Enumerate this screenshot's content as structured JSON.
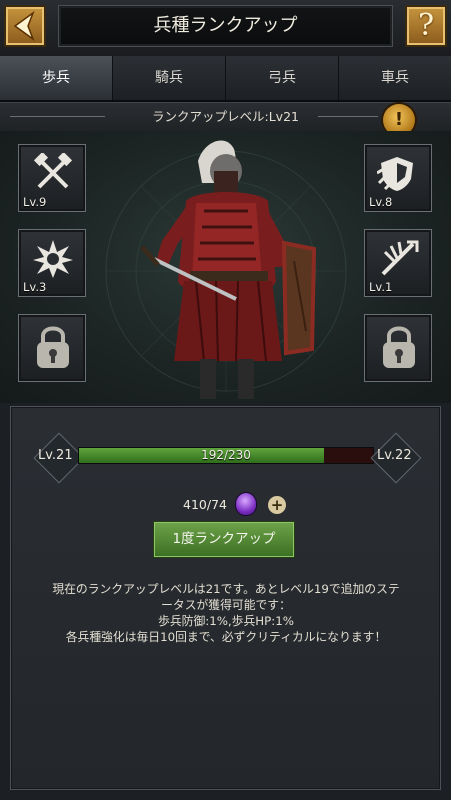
{
  "header": {
    "title": "兵種ランクアップ",
    "help_label": "?"
  },
  "tabs": [
    {
      "label": "歩兵",
      "active": true
    },
    {
      "label": "騎兵",
      "active": false
    },
    {
      "label": "弓兵",
      "active": false
    },
    {
      "label": "車兵",
      "active": false
    }
  ],
  "rank": {
    "label": "ランクアップレベル:Lv21",
    "info_label": "!"
  },
  "skills": {
    "left": [
      {
        "icon": "crossed-hammers-icon",
        "level": "Lv.9"
      },
      {
        "icon": "starburst-icon",
        "level": "Lv.3"
      },
      {
        "icon": "padlock-icon",
        "level": ""
      }
    ],
    "right": [
      {
        "icon": "shield-burst-icon",
        "level": "Lv.8"
      },
      {
        "icon": "slash-arrows-icon",
        "level": "Lv.1"
      },
      {
        "icon": "padlock-icon",
        "level": ""
      }
    ]
  },
  "progress": {
    "current_level": "Lv.21",
    "next_level": "Lv.22",
    "text": "192/230",
    "fraction": 0.8348
  },
  "cost": {
    "text": "410/74",
    "plus_label": "+"
  },
  "upgrade_button": "1度ランクアップ",
  "description": [
    "現在のランクアップレベルは21です。あとレベル19で追加のステ",
    "ータスが獲得可能です：",
    "歩兵防御:1%,歩兵HP:1%",
    "各兵種強化は毎日10回まで、必ずクリティカルになります！"
  ],
  "colors": {
    "accent_gold": "#c6953e",
    "button_green": "#5a8f3a",
    "bar_red": "#2a0d0d"
  }
}
